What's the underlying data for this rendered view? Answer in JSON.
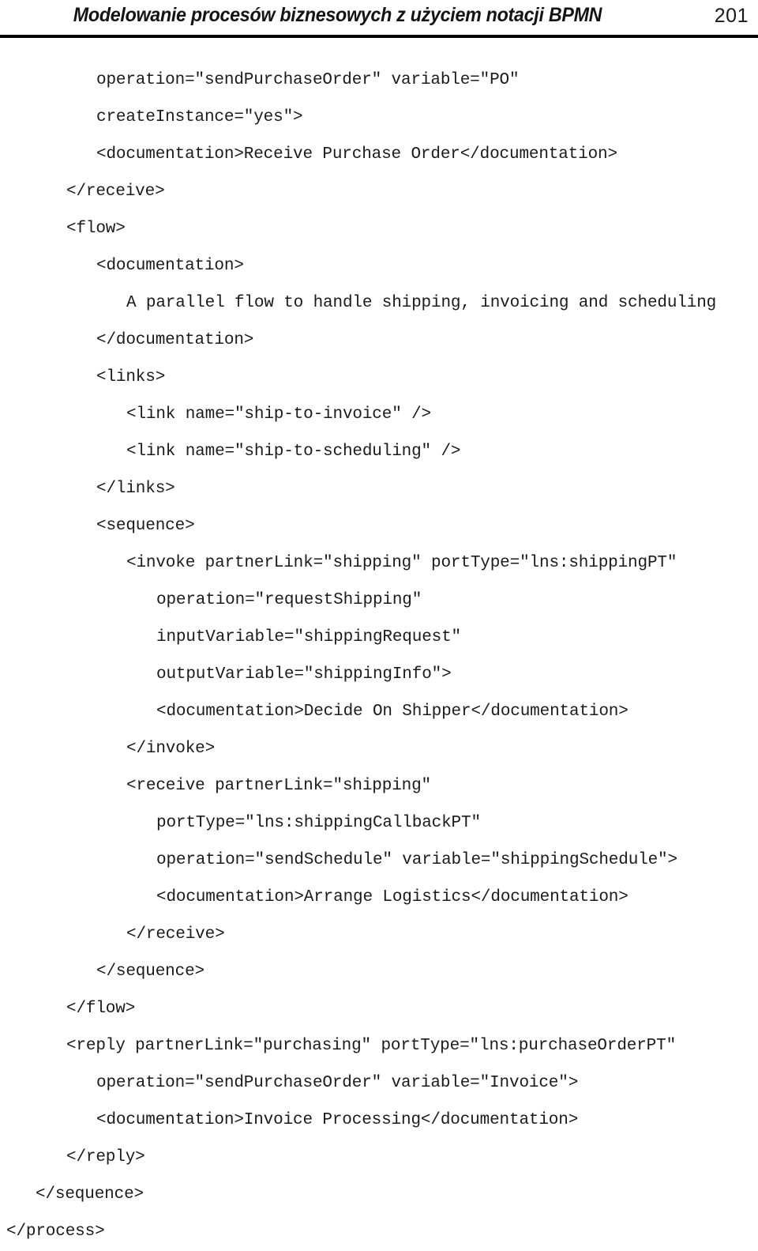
{
  "header": {
    "title": "Modelowanie procesów biznesowych z użyciem notacji BPMN",
    "page_number": "201"
  },
  "code": {
    "language": "xml",
    "lines": [
      {
        "indent": 3,
        "text": "operation=\"sendPurchaseOrder\" variable=\"PO\""
      },
      {
        "indent": 3,
        "text": "createInstance=\"yes\">"
      },
      {
        "indent": 3,
        "text": "<documentation>Receive Purchase Order</documentation>"
      },
      {
        "indent": 2,
        "text": "</receive>"
      },
      {
        "indent": 2,
        "text": "<flow>"
      },
      {
        "indent": 3,
        "text": "<documentation>"
      },
      {
        "indent": 4,
        "text": "A parallel flow to handle shipping, invoicing and scheduling"
      },
      {
        "indent": 3,
        "text": "</documentation>"
      },
      {
        "indent": 3,
        "text": "<links>"
      },
      {
        "indent": 4,
        "text": "<link name=\"ship-to-invoice\" />"
      },
      {
        "indent": 4,
        "text": "<link name=\"ship-to-scheduling\" />"
      },
      {
        "indent": 3,
        "text": "</links>"
      },
      {
        "indent": 3,
        "text": "<sequence>"
      },
      {
        "indent": 4,
        "text": "<invoke partnerLink=\"shipping\" portType=\"lns:shippingPT\""
      },
      {
        "indent": 5,
        "text": "operation=\"requestShipping\""
      },
      {
        "indent": 5,
        "text": "inputVariable=\"shippingRequest\""
      },
      {
        "indent": 5,
        "text": "outputVariable=\"shippingInfo\">"
      },
      {
        "indent": 5,
        "text": "<documentation>Decide On Shipper</documentation>"
      },
      {
        "indent": 4,
        "text": "</invoke>"
      },
      {
        "indent": 4,
        "text": "<receive partnerLink=\"shipping\""
      },
      {
        "indent": 5,
        "text": "portType=\"lns:shippingCallbackPT\""
      },
      {
        "indent": 5,
        "text": "operation=\"sendSchedule\" variable=\"shippingSchedule\">"
      },
      {
        "indent": 5,
        "text": "<documentation>Arrange Logistics</documentation>"
      },
      {
        "indent": 4,
        "text": "</receive>"
      },
      {
        "indent": 3,
        "text": "</sequence>"
      },
      {
        "indent": 2,
        "text": "</flow>"
      },
      {
        "indent": 2,
        "text": "<reply partnerLink=\"purchasing\" portType=\"lns:purchaseOrderPT\""
      },
      {
        "indent": 3,
        "text": "operation=\"sendPurchaseOrder\" variable=\"Invoice\">"
      },
      {
        "indent": 3,
        "text": "<documentation>Invoice Processing</documentation>"
      },
      {
        "indent": 2,
        "text": "</reply>"
      },
      {
        "indent": 1,
        "text": "</sequence>"
      },
      {
        "indent": 0,
        "text": "</process>"
      }
    ]
  }
}
